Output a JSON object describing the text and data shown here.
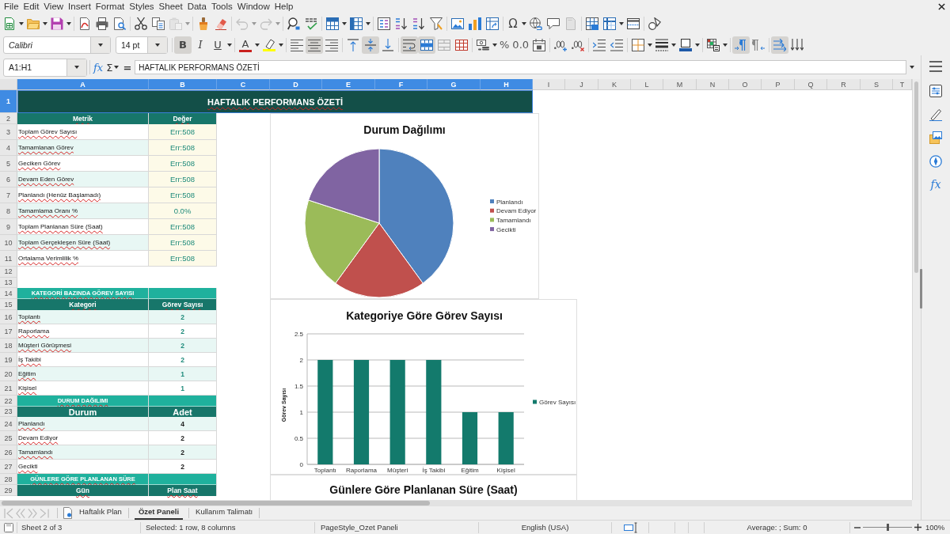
{
  "menu_bar": [
    "File",
    "Edit",
    "View",
    "Insert",
    "Format",
    "Styles",
    "Sheet",
    "Data",
    "Tools",
    "Window",
    "Help"
  ],
  "standard_toolbar": {
    "paste_disabled": true,
    "undo_disabled": true,
    "redo_disabled": true,
    "special_character_label": "Ω"
  },
  "formatting_toolbar": {
    "font_name": "Calibri",
    "font_missing": true,
    "font_size": "14 pt",
    "style_buttons": [
      {
        "kind": "bold",
        "label": "B",
        "on": true
      },
      {
        "kind": "italic",
        "label": "I",
        "on": false
      },
      {
        "kind": "underline",
        "label": "U",
        "on": false
      }
    ],
    "font_color_label": "A",
    "horizontal_align": [
      {
        "kind": "left",
        "selected": false
      },
      {
        "kind": "center",
        "selected": true
      },
      {
        "kind": "right",
        "selected": false
      }
    ],
    "vertical_align": [
      {
        "kind": "top",
        "selected": false
      },
      {
        "kind": "center",
        "selected": true
      },
      {
        "kind": "bottom",
        "selected": false
      }
    ],
    "wrap_text": true,
    "merge_and_center": true,
    "percent_label": "%",
    "standard_format_label": "0.0",
    "paragraph_direction": [
      {
        "kind": "ltr",
        "selected": true
      },
      {
        "kind": "rtl",
        "selected": false
      }
    ],
    "text_direction": [
      {
        "kind": "horizontal",
        "selected": true
      },
      {
        "kind": "vertical",
        "selected": false
      }
    ]
  },
  "formula_bar": {
    "name_box": "A1:H1",
    "function_wizard_label": "fx",
    "sum_label": "Σ",
    "formula_label": "=",
    "content": "HAFTALIK PERFORMANS ÖZETİ"
  },
  "sheet": {
    "autospell": true,
    "columns": [
      {
        "label": "A",
        "selected": true
      },
      {
        "label": "B",
        "selected": true
      },
      {
        "label": "C",
        "selected": true
      },
      {
        "label": "D",
        "selected": true
      },
      {
        "label": "E",
        "selected": true
      },
      {
        "label": "F",
        "selected": true
      },
      {
        "label": "G",
        "selected": true
      },
      {
        "label": "H",
        "selected": true
      },
      {
        "label": "I",
        "selected": false
      },
      {
        "label": "J",
        "selected": false
      },
      {
        "label": "K",
        "selected": false
      },
      {
        "label": "L",
        "selected": false
      },
      {
        "label": "M",
        "selected": false
      },
      {
        "label": "N",
        "selected": false
      },
      {
        "label": "O",
        "selected": false
      },
      {
        "label": "P",
        "selected": false
      },
      {
        "label": "Q",
        "selected": false
      },
      {
        "label": "R",
        "selected": false
      },
      {
        "label": "S",
        "selected": false
      },
      {
        "label": "T",
        "selected": false
      }
    ],
    "rows": [
      {
        "number": "1",
        "selected": true,
        "kind": "title",
        "cells": [
          "HAFTALIK PERFORMANS ÖZETİ"
        ]
      },
      {
        "number": "2",
        "selected": false,
        "kind": "header",
        "cells": [
          "Metrik",
          "Değer"
        ]
      },
      {
        "number": "3",
        "selected": false,
        "kind": "metric",
        "shaded": false,
        "cells": [
          "Toplam Görev Sayısı",
          "Err:508"
        ]
      },
      {
        "number": "4",
        "selected": false,
        "kind": "metric",
        "shaded": true,
        "cells": [
          "Tamamlanan Görev",
          "Err:508"
        ]
      },
      {
        "number": "5",
        "selected": false,
        "kind": "metric",
        "shaded": false,
        "cells": [
          "Geciken Görev",
          "Err:508"
        ]
      },
      {
        "number": "6",
        "selected": false,
        "kind": "metric",
        "shaded": true,
        "cells": [
          "Devam Eden Görev",
          "Err:508"
        ]
      },
      {
        "number": "7",
        "selected": false,
        "kind": "metric",
        "shaded": false,
        "cells": [
          "Planlandı (Henüz Başlamadı)",
          "Err:508"
        ]
      },
      {
        "number": "8",
        "selected": false,
        "kind": "metric",
        "shaded": true,
        "cells": [
          "Tamamlama Oranı %",
          "0.0%"
        ]
      },
      {
        "number": "9",
        "selected": false,
        "kind": "metric",
        "shaded": false,
        "cells": [
          "Toplam Planlanan Süre (Saat)",
          "Err:508"
        ]
      },
      {
        "number": "10",
        "selected": false,
        "kind": "metric",
        "shaded": true,
        "cells": [
          "Toplam Gerçekleşen Süre (Saat)",
          "Err:508"
        ]
      },
      {
        "number": "11",
        "selected": false,
        "kind": "metric",
        "shaded": false,
        "cells": [
          "Ortalama Verimlilik %",
          "Err:508"
        ]
      },
      {
        "number": "12",
        "selected": false,
        "kind": "blank"
      },
      {
        "number": "13",
        "selected": false,
        "kind": "blank"
      },
      {
        "number": "14",
        "selected": false,
        "kind": "section",
        "cells": [
          "KATEGORİ BAZINDA GÖREV SAYISI"
        ]
      },
      {
        "number": "15",
        "selected": false,
        "kind": "header",
        "cells": [
          "Kategori",
          "Görev Sayısı"
        ]
      },
      {
        "number": "16",
        "selected": false,
        "kind": "count",
        "shaded": true,
        "cells": [
          "Toplantı",
          "2"
        ]
      },
      {
        "number": "17",
        "selected": false,
        "kind": "count",
        "shaded": false,
        "cells": [
          "Raporlama",
          "2"
        ]
      },
      {
        "number": "18",
        "selected": false,
        "kind": "count",
        "shaded": true,
        "cells": [
          "Müşteri Görüşmesi",
          "2"
        ]
      },
      {
        "number": "19",
        "selected": false,
        "kind": "count",
        "shaded": false,
        "cells": [
          "İş Takibi",
          "2"
        ]
      },
      {
        "number": "20",
        "selected": false,
        "kind": "count",
        "shaded": true,
        "cells": [
          "Eğitim",
          "1"
        ]
      },
      {
        "number": "21",
        "selected": false,
        "kind": "count",
        "shaded": false,
        "cells": [
          "Kişisel",
          "1"
        ]
      },
      {
        "number": "22",
        "selected": false,
        "kind": "section",
        "cells": [
          "DURUM DAĞILIMI"
        ]
      },
      {
        "number": "23",
        "selected": false,
        "kind": "heading",
        "cells": [
          "Durum",
          "Adet"
        ]
      },
      {
        "number": "24",
        "selected": false,
        "kind": "status",
        "shaded": true,
        "cells": [
          "Planlandı",
          "4"
        ]
      },
      {
        "number": "25",
        "selected": false,
        "kind": "status",
        "shaded": false,
        "cells": [
          "Devam Ediyor",
          "2"
        ]
      },
      {
        "number": "26",
        "selected": false,
        "kind": "status",
        "shaded": true,
        "cells": [
          "Tamamlandı",
          "2"
        ]
      },
      {
        "number": "27",
        "selected": false,
        "kind": "status",
        "shaded": false,
        "cells": [
          "Gecikti",
          "2"
        ]
      },
      {
        "number": "28",
        "selected": false,
        "kind": "section",
        "cells": [
          "GÜNLERE GÖRE PLANLANAN SÜRE"
        ]
      },
      {
        "number": "29",
        "selected": false,
        "kind": "header",
        "cells": [
          "Gün",
          "Plan Saat"
        ]
      }
    ],
    "charts": [
      {
        "chart_data": {
          "type": "pie",
          "title": "Durum Dağılımı",
          "categories": [
            "Planlandı",
            "Devam Ediyor",
            "Tamamlandı",
            "Gecikti"
          ],
          "values": [
            40,
            20,
            20,
            20
          ],
          "colors": [
            "#4f81bd",
            "#c0504d",
            "#9bbb59",
            "#8064a2"
          ],
          "legend": "right"
        }
      },
      {
        "chart_data": {
          "type": "bar",
          "title": "Kategoriye Göre Görev Sayısı",
          "ylabel": "Görev Sayısı",
          "categories": [
            "Toplantı",
            "Raporlama",
            "Müşteri",
            "İş Takibi",
            "Eğitim",
            "Kişisel"
          ],
          "series": [
            {
              "name": "Görev Sayısı",
              "color": "#137a6c",
              "values": [
                2,
                2,
                2,
                2,
                1,
                1
              ]
            }
          ],
          "ylim": [
            0,
            2.5
          ],
          "yticks": [
            0,
            0.5,
            1,
            1.5,
            2,
            2.5
          ],
          "grid": true,
          "legend": "right"
        }
      },
      {
        "title": "Günlere Göre Planlanan Süre (Saat)"
      }
    ]
  },
  "sidebar": {
    "functions_label": "fx"
  },
  "sheet_tabs": [
    {
      "label": "Haftalık Plan",
      "selected": false
    },
    {
      "label": "Özet Paneli",
      "selected": true
    },
    {
      "label": "Kullanım Talimatı",
      "selected": false
    }
  ],
  "status_bar": {
    "sheet": "Sheet 2 of 3",
    "selection": "Selected: 1 row, 8 columns",
    "page_style": "PageStyle_Ozet Paneli",
    "language": "English (USA)",
    "statistics": "Average: ; Sum: 0",
    "zoom": {
      "label": "100%",
      "level": 0.5
    }
  }
}
